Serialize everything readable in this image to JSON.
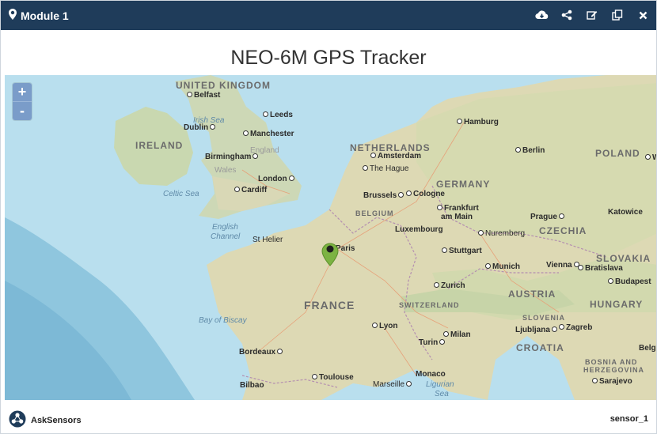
{
  "header": {
    "title": "Module 1",
    "bg_color": "#1f3c5a",
    "icons": [
      "map-marker-icon",
      "cloud-download-icon",
      "share-icon",
      "edit-icon",
      "copy-icon",
      "close-icon"
    ]
  },
  "map": {
    "title": "NEO-6M GPS Tracker",
    "zoom_in": "+",
    "zoom_out": "-",
    "marker_color": "#7cb342",
    "labels": {
      "uk": "UNITED KINGDOM",
      "ireland": "IRELAND",
      "netherlands": "NETHERLANDS",
      "belgium": "BELGIUM",
      "germany": "GERMANY",
      "poland": "POLAND",
      "czechia": "CZECHIA",
      "slovakia": "SLOVAKIA",
      "austria": "AUSTRIA",
      "hungary": "HUNGARY",
      "slovenia": "SLOVENIA",
      "croatia": "CROATIA",
      "bosnia1": "BOSNIA AND",
      "bosnia2": "HERZEGOVINA",
      "france": "FRANCE",
      "switzerland": "SWITZERLAND",
      "england": "England",
      "wales": "Wales",
      "irish_sea": "Irish Sea",
      "celtic_sea": "Celtic Sea",
      "english_channel1": "English",
      "english_channel2": "Channel",
      "bay_of_biscay": "Bay of Biscay",
      "ligurian1": "Ligurian",
      "ligurian2": "Sea",
      "belfast": "Belfast",
      "dublin": "Dublin",
      "leeds": "Leeds",
      "manchester": "Manchester",
      "birmingham": "Birmingham",
      "london": "London",
      "cardiff": "Cardiff",
      "amsterdam": "Amsterdam",
      "the_hague": "The Hague",
      "brussels": "Brussels",
      "cologne": "Cologne",
      "hamburg": "Hamburg",
      "berlin": "Berlin",
      "frankfurt1": "Frankfurt",
      "frankfurt2": "am Main",
      "luxembourg": "Luxembourg",
      "st_helier": "St Helier",
      "paris": "Paris",
      "prague": "Prague",
      "katowice": "Katowice",
      "nuremberg": "Nuremberg",
      "stuttgart": "Stuttgart",
      "munich": "Munich",
      "vienna": "Vienna",
      "bratislava": "Bratislava",
      "budapest": "Budapest",
      "zurich": "Zurich",
      "lyon": "Lyon",
      "milan": "Milan",
      "turin": "Turin",
      "ljubljana": "Ljubljana",
      "zagreb": "Zagreb",
      "bordeaux": "Bordeaux",
      "toulouse": "Toulouse",
      "marseille": "Marseille",
      "monaco": "Monaco",
      "bilbao": "Bilbao",
      "sarajevo": "Sarajevo",
      "bel": "Belg",
      "w": "W"
    }
  },
  "footer": {
    "brand": "AskSensors",
    "sensor": "sensor_1"
  }
}
